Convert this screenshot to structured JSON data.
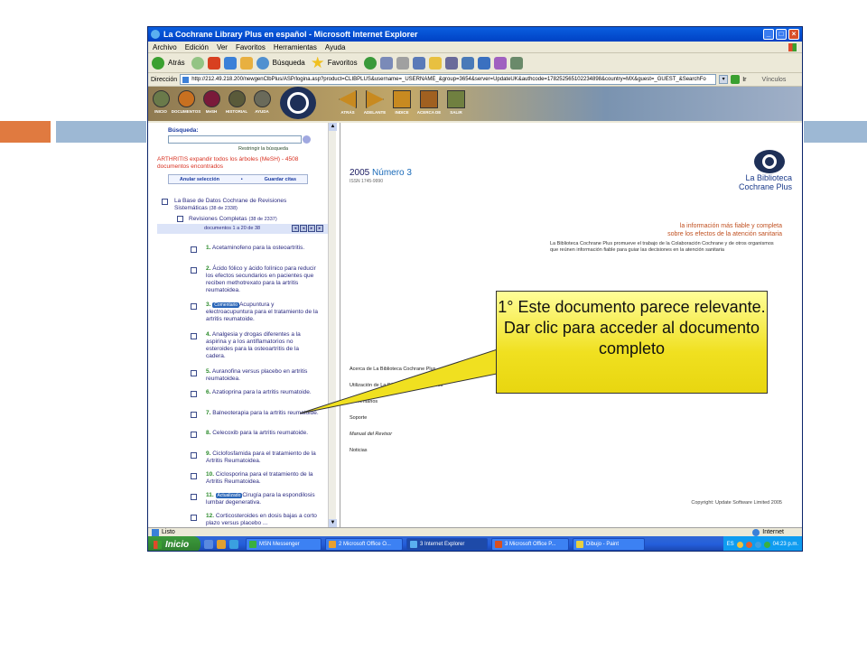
{
  "window": {
    "title": "La Cochrane Library Plus en español - Microsoft Internet Explorer"
  },
  "menu": [
    "Archivo",
    "Edición",
    "Ver",
    "Favoritos",
    "Herramientas",
    "Ayuda"
  ],
  "toolbar": {
    "back_label": "Atrás",
    "search_label": "Búsqueda",
    "favorites_label": "Favoritos"
  },
  "address": {
    "label": "Dirección",
    "url": "http://212.49.218.200/newgenClbPlus/ASP/logina.asp?product=CLIBPLUS&username=_USERNAME_&group=3654&server=UpdateUK&authcode=178252565102234898&country=MX&guest=_GUEST_&SearchFo",
    "go_label": "Ir",
    "links_label": "Vínculos"
  },
  "banner": {
    "left_icons": [
      "INICIO",
      "DOCUMENTOS",
      "MeSH",
      "HISTORIAL",
      "AYUDA"
    ],
    "nav_icons": [
      "ATRÁS",
      "ADELANTE",
      "INDICE",
      "ACERCA DE",
      "SALIR"
    ]
  },
  "left": {
    "search_label": "Búsqueda:",
    "restrict_label": "Restringir la búsqueda",
    "results_text": "ARTHRITIS expandir todos los árboles (MeSH) - 4508 documentos encontrados",
    "deselect_label": "Anular selección",
    "save_label": "Guardar citas",
    "database": "La Base de Datos Cochrane de Revisiones Sistemáticas",
    "database_count": "(38 de 2338)",
    "reviews": "Revisiones Completas",
    "reviews_count": "(38 de 2337)",
    "range": "documentos 1 a 20 de 38",
    "items": [
      {
        "n": "1.",
        "text": "Acetaminofeno para la osteoartritis."
      },
      {
        "n": "2.",
        "text": "Ácido fólico y ácido folínico para reducir los efectos secundarios en pacientes que reciben methotrexato para la artritis reumatoidea."
      },
      {
        "n": "3.",
        "badge": "Comentario",
        "text": "Acupuntura y electroacupuntura para el tratamiento de la artritis reumatoide."
      },
      {
        "n": "4.",
        "text": "Analgesia y drogas diferentes a la aspirina y a los antiflamatorios no esteroides para la osteoartritis de la cadera."
      },
      {
        "n": "5.",
        "text": "Auranofina versus placebo en artritis reumatoidea."
      },
      {
        "n": "6.",
        "text": "Azatioprina para la artritis reumatoide."
      },
      {
        "n": "7.",
        "text": "Balneoterapia para la artritis reumatoide."
      },
      {
        "n": "8.",
        "text": "Celecoxib para la artritis reumatoide."
      },
      {
        "n": "9.",
        "text": "Ciclofosfamida para el tratamiento de la Artritis Reumatoidea."
      },
      {
        "n": "10.",
        "text": "Ciclosporina para el tratamiento de la Artritis Reumatoidea."
      },
      {
        "n": "11.",
        "badge": "Actualizado",
        "text": "Cirugía para la espondilosis lumbar degenerativa."
      },
      {
        "n": "12.",
        "text": "Corticosteroides en dosis bajas a corto plazo versus placebo ..."
      }
    ]
  },
  "right": {
    "year": "2005",
    "issue": "Número 3",
    "issn": "ISSN 1745-9990",
    "logo_line1": "La Biblioteca",
    "logo_line2": "Cochrane Plus",
    "slogan1": "la información más fiable y completa",
    "slogan2": "sobre los efectos de la atención sanitaria",
    "blurb": "La Biblioteca Cochrane Plus promueve el trabajo de la Colaboración Cochrane y de otros organismos que reúnen información fiable para guiar las decisiones en la atención sanitaria",
    "links": [
      "Acerca de La Biblioteca Cochrane Plus",
      "Utilización de La Biblioteca Cochrane Plus",
      "Comentarios",
      "Soporte",
      "Manual del Revisor",
      "Noticias"
    ],
    "copyright": "Copyright: Update Software Limited 2005"
  },
  "status": {
    "text": "Listo",
    "zone": "Internet"
  },
  "taskbar": {
    "start": "Inicio",
    "tasks": [
      "MSN Messenger",
      "2 Microsoft Office O...",
      "3 Internet Explorer",
      "3 Microsoft Office P...",
      "Dibujo - Paint"
    ],
    "lang": "ES",
    "clock": "04:23 p.m."
  },
  "callout": {
    "text": "1° Este documento parece relevante. Dar clic para acceder al documento completo"
  }
}
